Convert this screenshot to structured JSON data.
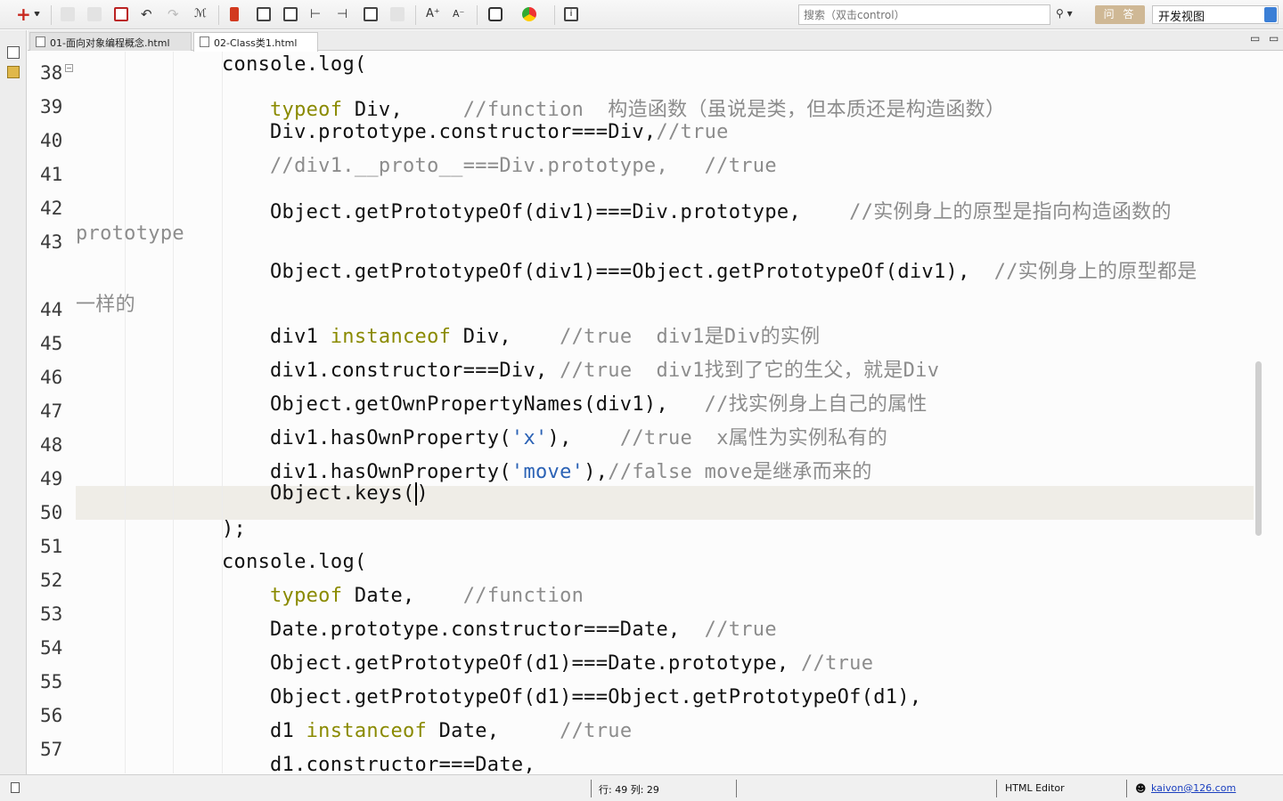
{
  "toolbar": {
    "search_placeholder": "搜索（双击control）",
    "search_button_icon": "search-icon",
    "qa_button_label": "问 答",
    "view_select_value": "开发视图",
    "colors": {
      "qa_button": "#cfb895",
      "accent_blue": "#3b7fd6",
      "plus_red": "#c8281e"
    }
  },
  "tabs": [
    {
      "label": "01-面向对象编程概念.html"
    },
    {
      "label": "02-Class类1.html",
      "close": "☒"
    }
  ],
  "window_controls": {
    "minimize": "▭",
    "maximize": "▭"
  },
  "editor": {
    "line_numbers": [
      "38",
      "39",
      "40",
      "41",
      "42",
      "43",
      "44",
      "45",
      "46",
      "47",
      "48",
      "49",
      "50",
      "51",
      "52",
      "53",
      "54",
      "55",
      "56",
      "57"
    ],
    "current_line": "50",
    "code": {
      "l38": "console.log(",
      "l39_kw": "typeof",
      "l39_rest": " Div,     ",
      "l39_c": "//function  构造函数（虽说是类，但本质还是构造函数）",
      "l40_code": "Div.prototype.constructor===Div,",
      "l40_c": "//true",
      "l41_c": "//div1.__proto__===Div.prototype,   //true",
      "l42_code": "Object.getPrototypeOf(div1)===Div.prototype,    ",
      "l42_c": "//实例身上的原型是指向构造函数的",
      "l43_wrap": "prototype",
      "l43_code": "Object.getPrototypeOf(div1)===Object.getPrototypeOf(div1),  ",
      "l43_c": "//实例身上的原型都是",
      "l44_wrap": "一样的",
      "l45_a": "div1 ",
      "l45_kw": "instanceof",
      "l45_b": " Div,    ",
      "l45_c": "//true  div1是Div的实例",
      "l46_code": "div1.constructor===Div, ",
      "l46_c": "//true  div1找到了它的生父，就是Div",
      "l47_code": "Object.getOwnPropertyNames(div1),   ",
      "l47_c": "//找实例身上自己的属性",
      "l48_a": "div1.hasOwnProperty(",
      "l48_s": "'x'",
      "l48_b": "),    ",
      "l48_c": "//true  x属性为实例私有的",
      "l49_a": "div1.hasOwnProperty(",
      "l49_s": "'move'",
      "l49_b": "),",
      "l49_c": "//false move是继承而来的",
      "l50_a": "Object.keys(",
      "l50_b": ")",
      "l51": ");",
      "l52": "console.log(",
      "l53_kw": "typeof",
      "l53_rest": " Date,    ",
      "l53_c": "//function",
      "l54_code": "Date.prototype.constructor===Date,  ",
      "l54_c": "//true",
      "l55_code": "Object.getPrototypeOf(d1)===Date.prototype, ",
      "l55_c": "//true",
      "l56_code": "Object.getPrototypeOf(d1)===Object.getPrototypeOf(d1),",
      "l57_a": "d1 ",
      "l57_kw": "instanceof",
      "l57_b": " Date,     ",
      "l57_c": "//true",
      "l58_code": "d1.constructor===Date,"
    },
    "colors": {
      "keyword": "#8a8a00",
      "comment": "#8c8c8c",
      "string": "#2b62b5",
      "current_line": "#efede7"
    }
  },
  "status": {
    "position": "行: 49 列: 29",
    "editor_type": "HTML Editor",
    "user": "kaivon@126.com"
  }
}
